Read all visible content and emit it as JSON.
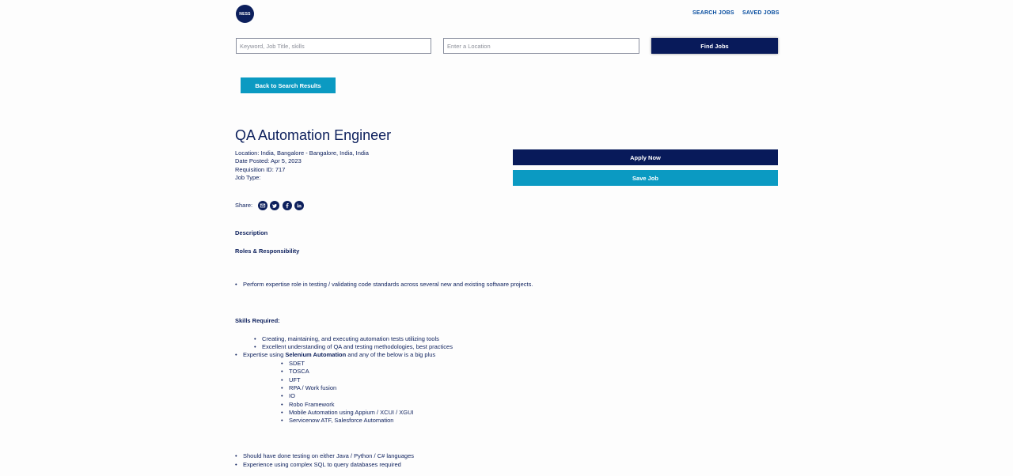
{
  "header": {
    "logo_text": "NESS",
    "nav": [
      "SEARCH JOBS",
      "SAVED JOBS"
    ]
  },
  "search": {
    "keyword_placeholder": "Keyword, Job Title, skills",
    "location_placeholder": "Enter a Location",
    "find_label": "Find Jobs"
  },
  "back_label": "Back to Search Results",
  "job": {
    "title": "QA Automation Engineer",
    "location": "Location: India, Bangalore - Bangalore, India, India",
    "date_posted": "Date Posted: Apr 5, 2023",
    "requisition": "Requisition ID: 717",
    "job_type": "Job Type:",
    "apply_label": "Apply Now",
    "save_label": "Save Job"
  },
  "share": {
    "label": "Share:",
    "icons": [
      "email-icon",
      "twitter-icon",
      "facebook-icon",
      "linkedin-icon"
    ]
  },
  "description": {
    "heading": "Description",
    "roles_heading": "Roles & Responsibility",
    "roles": [
      "Perform expertise role in testing / validating code standards across several new and existing software projects."
    ],
    "skills_heading": "Skills Required:",
    "skills_sub": [
      "Creating, maintaining, and executing automation tests utilizing tools",
      "Excellent understanding of QA and testing methodologies, best practices"
    ],
    "expertise_prefix": "Expertise using ",
    "expertise_bold": "Selenium Automation",
    "expertise_suffix": " and any of the below is a big plus",
    "tools": [
      "SDET",
      "TOSCA",
      "UFT",
      "RPA / Work fusion",
      "IO",
      "Robo Framework",
      "Mobile Automation using Appium / XCUI / XGUI",
      "Servicenow ATF, Salesforce Automation"
    ],
    "more": [
      "Should have done testing on either Java / Python / C# languages",
      "Experience using complex SQL to query databases required"
    ]
  },
  "colors": {
    "navy": "#081a5a",
    "teal": "#0b9ac2",
    "link": "#0a4fa0"
  }
}
